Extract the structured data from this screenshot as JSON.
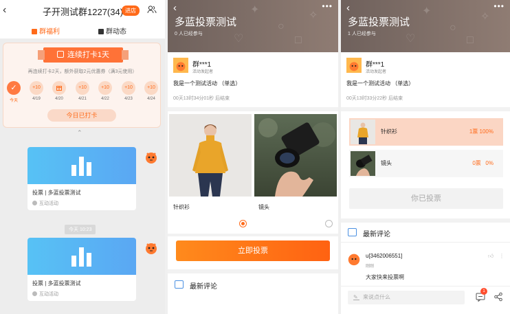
{
  "colors": {
    "accent": "#ff6a19",
    "vote_button": "#ff7016",
    "winner_bg": "#fbd6c4",
    "card_blue": "#57c2f5"
  },
  "group_chat": {
    "title": "子开测试群1227(34)",
    "enter_badge": "进店",
    "tabs": [
      {
        "label": "群福利",
        "active": true
      },
      {
        "label": "群动态",
        "active": false
      }
    ],
    "checkin": {
      "banner": "连续打卡1天",
      "subtitle": "再连续打卡2天，额外获取2元优惠券（满3元使用）",
      "days": [
        {
          "reward": "✓",
          "date": "今天"
        },
        {
          "reward": "+10",
          "date": "4/19"
        },
        {
          "reward": "gift",
          "date": "4/20"
        },
        {
          "reward": "+10",
          "date": "4/21"
        },
        {
          "reward": "+10",
          "date": "4/22"
        },
        {
          "reward": "+10",
          "date": "4/23"
        },
        {
          "reward": "+10",
          "date": "4/24"
        }
      ],
      "done_label": "今日已打卡"
    },
    "messages": [
      {
        "title": "投票 | 多蓝投票测试",
        "sub": "互动活动"
      },
      {
        "title": "投票 | 多蓝投票测试",
        "sub": "互动活动"
      }
    ],
    "time_divider": "今天 10:23"
  },
  "vote_page": {
    "title": "多蓝投票测试",
    "participants": "0 人已经参与",
    "organizer": {
      "name": "群***1",
      "role": "活动发起者"
    },
    "description": "我是一个测试活动 （单选）",
    "countdown": "00天13时34分01秒 后结束",
    "options": [
      {
        "label": "针织衫",
        "selected": true
      },
      {
        "label": "镜头",
        "selected": false
      }
    ],
    "vote_button": "立即投票",
    "comments_header": "最新评论"
  },
  "result_page": {
    "title": "多蓝投票测试",
    "participants": "1 人已经参与",
    "organizer": {
      "name": "群***1",
      "role": "活动发起者"
    },
    "description": "我是一个测试活动 （单选）",
    "countdown": "00天13时33分22秒 后结束",
    "results": [
      {
        "label": "针织衫",
        "count": "1票 100%",
        "share": 1.0
      },
      {
        "label": "镜头",
        "count": "0票   0%",
        "share": 0.0
      }
    ],
    "voted_button": "你已投票",
    "comments_header": "最新评论",
    "comment": {
      "user": "u[3462006551]",
      "time": "刚刚",
      "text": "大家快来投票啊"
    },
    "comment_input_placeholder": "来说点什么",
    "message_badge": "1"
  }
}
